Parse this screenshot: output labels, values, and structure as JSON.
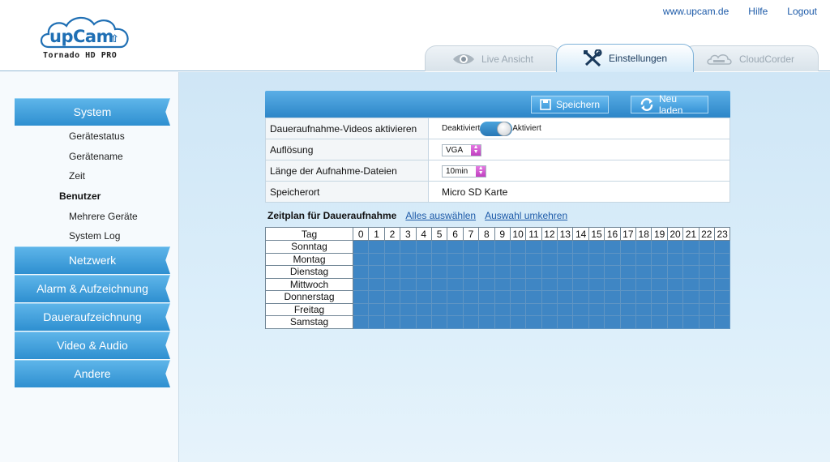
{
  "header": {
    "logo": {
      "brand": "upCam",
      "model": "Tornado HD PRO"
    },
    "links": [
      "www.upcam.de",
      "Hilfe",
      "Logout"
    ],
    "tabs": [
      {
        "label": "Live Ansicht",
        "icon": "eye-icon",
        "active": false
      },
      {
        "label": "Einstellungen",
        "icon": "tools-icon",
        "active": true
      },
      {
        "label": "CloudCorder",
        "icon": "cloud-icon",
        "active": false
      }
    ]
  },
  "sidebar": {
    "sections": [
      {
        "label": "System"
      },
      {
        "label": "Netzwerk"
      },
      {
        "label": "Alarm & Aufzeichnung"
      },
      {
        "label": "Daueraufzeichnung"
      },
      {
        "label": "Video & Audio"
      },
      {
        "label": "Andere"
      }
    ],
    "system_items": [
      {
        "label": "Gerätestatus",
        "active": false
      },
      {
        "label": "Gerätename",
        "active": false
      },
      {
        "label": "Zeit",
        "active": false
      },
      {
        "label": "Benutzer",
        "active": true
      },
      {
        "label": "Mehrere Geräte",
        "active": false
      },
      {
        "label": "System Log",
        "active": false
      }
    ]
  },
  "toolbar": {
    "save_label": "Speichern",
    "reload_label": "Neu laden"
  },
  "settings": {
    "rows": [
      {
        "label": "Daueraufnahme-Videos aktivieren",
        "off_label": "Deaktiviert",
        "on_label": "Aktiviert",
        "enabled": true
      },
      {
        "label": "Auflösung",
        "value": "VGA"
      },
      {
        "label": "Länge der Aufnahme-Dateien",
        "value": "10min"
      },
      {
        "label": "Speicherort",
        "value": "Micro SD Karte"
      }
    ]
  },
  "schedule": {
    "title": "Zeitplan für Daueraufnahme",
    "select_all": "Alles auswählen",
    "invert": "Auswahl umkehren",
    "day_header": "Tag",
    "hours": [
      "0",
      "1",
      "2",
      "3",
      "4",
      "5",
      "6",
      "7",
      "8",
      "9",
      "10",
      "11",
      "12",
      "13",
      "14",
      "15",
      "16",
      "17",
      "18",
      "19",
      "20",
      "21",
      "22",
      "23"
    ],
    "days": [
      "Sonntag",
      "Montag",
      "Dienstag",
      "Mittwoch",
      "Donnerstag",
      "Freitag",
      "Samstag"
    ],
    "all_selected": true,
    "selected_color": "#3f86c4"
  },
  "colors": {
    "accent": "#2e8fd0",
    "link": "#1c5aa8"
  }
}
